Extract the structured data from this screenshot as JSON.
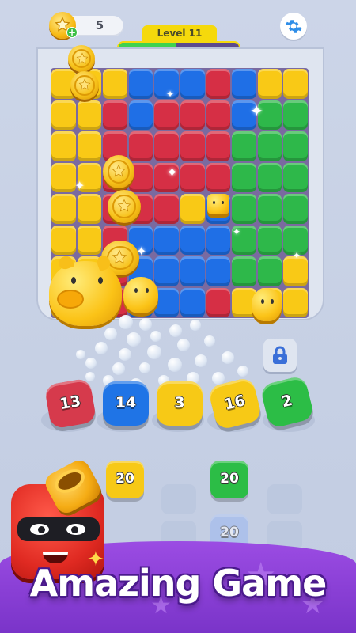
{
  "hud": {
    "coins": "5",
    "level_label": "Level 11",
    "progress_fraction": 0.48,
    "progress_color": "#3fd24f"
  },
  "colors": {
    "yellow": "#f9c916",
    "blue": "#1f6fe6",
    "red": "#d62f45",
    "green": "#2eb84a"
  },
  "board_columns": [
    [
      "yellow",
      "yellow",
      "yellow",
      "yellow",
      "yellow",
      "yellow",
      "yellow",
      "yellow"
    ],
    [
      "yellow",
      "yellow",
      "yellow",
      "yellow",
      "yellow",
      "yellow",
      "yellow",
      "yellow"
    ],
    [
      "yellow",
      "red",
      "red",
      "red",
      "red",
      "red",
      "red",
      "red"
    ],
    [
      "blue",
      "blue",
      "red",
      "red",
      "red",
      "blue",
      "blue",
      "blue"
    ],
    [
      "blue",
      "red",
      "red",
      "red",
      "red",
      "blue",
      "blue",
      "blue"
    ],
    [
      "blue",
      "red",
      "red",
      "red",
      "yellow",
      "blue",
      "blue",
      "blue"
    ],
    [
      "red",
      "red",
      "red",
      "red",
      "blue",
      "blue",
      "blue",
      "red"
    ],
    [
      "blue",
      "blue",
      "green",
      "green",
      "green",
      "green",
      "green",
      "yellow"
    ],
    [
      "yellow",
      "green",
      "green",
      "green",
      "green",
      "green",
      "green",
      "yellow"
    ],
    [
      "yellow",
      "green",
      "green",
      "green",
      "green",
      "green",
      "yellow",
      "yellow"
    ]
  ],
  "shooters": [
    {
      "count": "13",
      "color": "#d63a4c",
      "icon": "red-shooter"
    },
    {
      "count": "14",
      "color": "#1f74e6",
      "icon": "blue-shooter"
    },
    {
      "count": "3",
      "color": "#f7c916",
      "icon": "yellow-shooter"
    },
    {
      "count": "16",
      "color": "#f7c916",
      "icon": "yellow-shooter"
    },
    {
      "count": "2",
      "color": "#2cbd46",
      "icon": "green-shooter"
    }
  ],
  "queue": [
    {
      "count": "20",
      "color": "#f7c916"
    },
    {
      "count": "20",
      "color": "#2cbd46"
    },
    {
      "count": "20",
      "color": "#9cb8f0"
    }
  ],
  "banner": {
    "text": "Amazing Game"
  },
  "icons": [
    "star-coin-icon",
    "plus-icon",
    "gear-icon",
    "lock-icon",
    "piggy-bank-icon",
    "coin-icon",
    "mascot-icon",
    "cannon-icon"
  ]
}
